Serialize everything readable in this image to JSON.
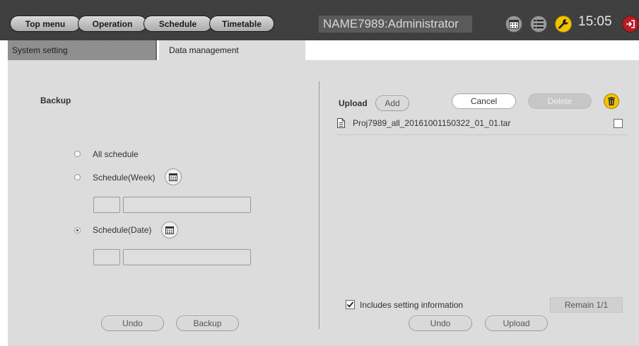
{
  "nav": {
    "items": [
      {
        "label": "Top menu"
      },
      {
        "label": "Operation"
      },
      {
        "label": "Schedule"
      },
      {
        "label": "Timetable"
      }
    ]
  },
  "header": {
    "user": "NAME7989:Administrator",
    "time": "15:05",
    "icons": [
      "calendar-icon",
      "list-icon",
      "wrench-icon",
      "logout-icon"
    ]
  },
  "tabs": [
    {
      "label": "System setting",
      "active": false
    },
    {
      "label": "Data management",
      "active": true
    }
  ],
  "backup": {
    "title": "Backup",
    "options": [
      {
        "label": "All schedule",
        "checked": false
      },
      {
        "label": "Schedule(Week)",
        "checked": false
      },
      {
        "label": "Schedule(Date)",
        "checked": true
      }
    ],
    "undo_label": "Undo",
    "backup_label": "Backup"
  },
  "upload": {
    "title": "Upload",
    "add_label": "Add",
    "cancel_label": "Cancel",
    "delete_label": "Delete",
    "files": [
      {
        "name": "Proj7989_all_20161001150322_01_01.tar",
        "checked": false
      }
    ],
    "include_setting_label": "Includes setting information",
    "include_setting_checked": true,
    "remain": "Remain 1/1",
    "undo_label": "Undo",
    "upload_label": "Upload"
  },
  "colors": {
    "topbar": "#3d3d3d",
    "panel": "#dcdcdc",
    "accent_yellow": "#f2c400",
    "logout_red": "#b21f24"
  }
}
